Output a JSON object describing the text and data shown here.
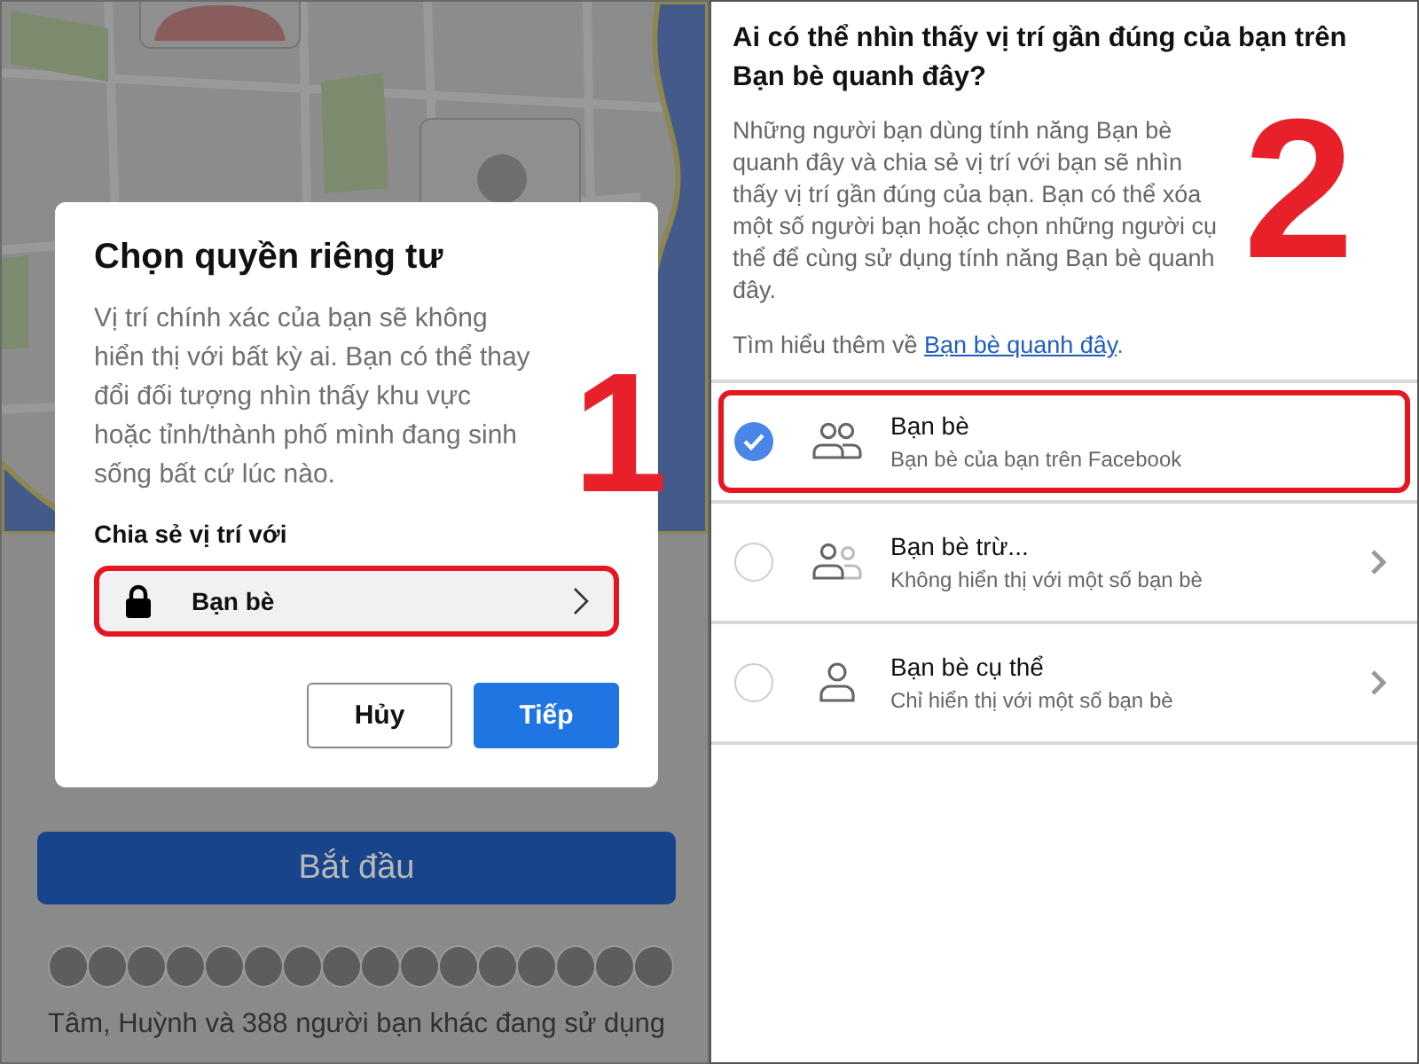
{
  "left_screen": {
    "background": {
      "start_button": "Bắt đầu",
      "friends_using": "Tâm, Huỳnh và 388 người bạn khác đang sử dụng"
    },
    "dialog": {
      "title": "Chọn quyền riêng tư",
      "description": "Vị trí chính xác của bạn sẽ không hiển thị với bất kỳ ai. Bạn có thể thay đổi đối tượng nhìn thấy khu vực hoặc tỉnh/thành phố mình đang sinh sống bất cứ lúc nào.",
      "share_label": "Chia sẻ vị trí với",
      "audience": {
        "label": "Bạn bè",
        "highlighted": true
      },
      "buttons": [
        {
          "label": "Hủy",
          "kind": "secondary"
        },
        {
          "label": "Tiếp",
          "kind": "primary"
        }
      ]
    },
    "step_number": "1"
  },
  "right_screen": {
    "title": "Ai có thể nhìn thấy vị trí gần đúng của bạn trên Bạn bè quanh đây?",
    "description": "Những người bạn dùng tính năng Bạn bè quanh đây và chia sẻ vị trí với bạn sẽ nhìn thấy vị trí gần đúng của bạn. Bạn có thể xóa một số người bạn hoặc chọn những người cụ thể để cùng sử dụng tính năng Bạn bè quanh đây.",
    "learn_more": {
      "text": "Tìm hiểu thêm về",
      "link": "Bạn bè quanh đây",
      "end": "."
    },
    "options": [
      {
        "kind": "friends",
        "title": "Bạn bè",
        "subtitle": "Bạn bè của bạn trên Facebook",
        "selected": true,
        "chevron": false,
        "highlighted": true
      },
      {
        "kind": "friends_except",
        "title": "Bạn bè trừ...",
        "subtitle": "Không hiển thị với một số bạn bè",
        "selected": false,
        "chevron": true,
        "highlighted": false
      },
      {
        "kind": "specific",
        "title": "Bạn bè cụ thể",
        "subtitle": "Chỉ hiển thị với một số bạn bè",
        "selected": false,
        "chevron": true,
        "highlighted": false
      }
    ],
    "step_number": "2"
  }
}
